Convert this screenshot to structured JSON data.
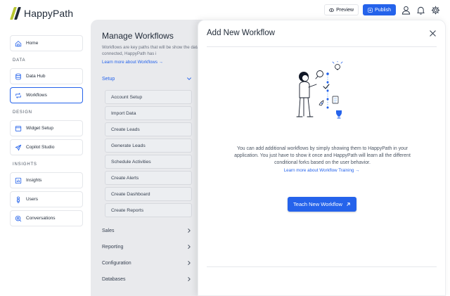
{
  "app": {
    "name": "HappyPath"
  },
  "header": {
    "preview_label": "Preview",
    "publish_label": "Publish"
  },
  "sidebar": {
    "top_items": [
      {
        "label": "Home"
      }
    ],
    "sections": [
      {
        "title": "DATA",
        "items": [
          {
            "label": "Data Hub"
          },
          {
            "label": "Workflows",
            "active": true
          }
        ]
      },
      {
        "title": "DESIGN",
        "items": [
          {
            "label": "Widget Setup"
          },
          {
            "label": "Copilot Studio"
          }
        ]
      },
      {
        "title": "INSIGHTS",
        "items": [
          {
            "label": "Insights"
          },
          {
            "label": "Users"
          },
          {
            "label": "Conversations"
          }
        ]
      }
    ]
  },
  "workflows_panel": {
    "title": "Manage Workflows",
    "description": "Workflows are key paths that will be show the data you connected, HappyPath has i",
    "learn_more": "Learn more about Workflows →",
    "setup": {
      "label": "Setup",
      "steps": [
        "Account Setup",
        "Import Data",
        "Create Leads",
        "Generate Leads",
        "Schedule Activities",
        "Create Alerts",
        "Create Dashboard",
        "Create Reports"
      ]
    },
    "categories": [
      "Sales",
      "Reporting",
      "Configuration",
      "Databases"
    ]
  },
  "drawer": {
    "title": "Add New Workflow",
    "body": "You can add additional workflows by simply showing them to HappyPath in your application. You just have to show it once and HappyPath will learn all the different conditional forks based on the user behavior.",
    "link": "Learn more about Workflow Training →",
    "button_label": "Teach New Workflow"
  },
  "colors": {
    "accent": "#2563eb",
    "brand_green": "#b7c62f",
    "panel_bg": "#e9eaed"
  }
}
